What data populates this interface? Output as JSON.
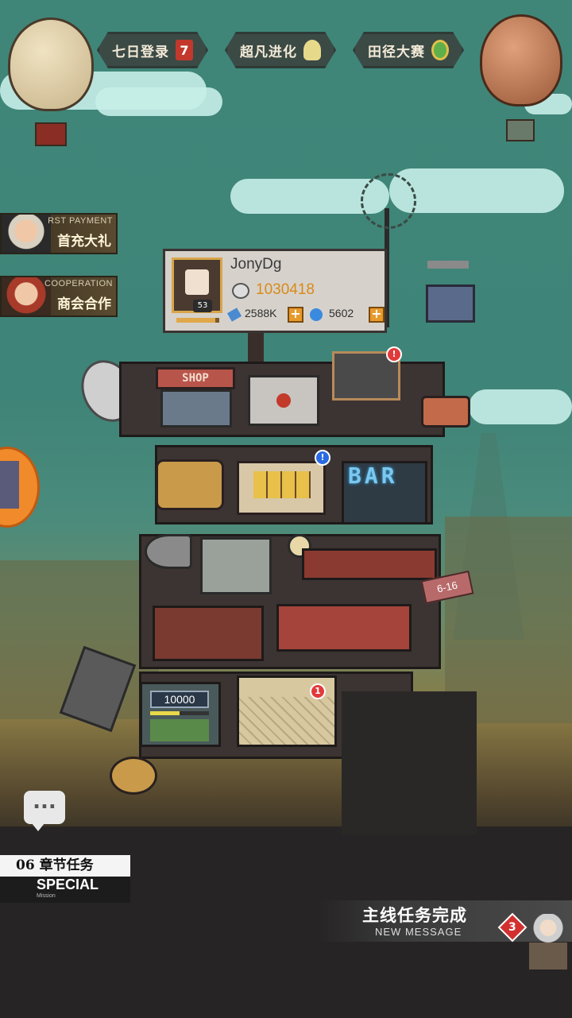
{
  "events": [
    {
      "label": "七日登录",
      "icon_name": "slot-seven-icon",
      "icon_text": "7",
      "icon_color": "#c2382c"
    },
    {
      "label": "超凡进化",
      "icon_name": "evolution-crystal-icon",
      "icon_text": "",
      "icon_color": "#e7d98a"
    },
    {
      "label": "田径大赛",
      "icon_name": "track-medal-icon",
      "icon_text": "",
      "icon_color": "#5fb04a"
    }
  ],
  "promos": [
    {
      "tag": "RST PAYMENT",
      "label": "首充大礼"
    },
    {
      "tag": "COOPERATION",
      "label": "商会合作"
    }
  ],
  "player": {
    "name": "JonyDg",
    "level": "53",
    "gold": "1030418",
    "crystal": "2588K",
    "gems": "5602",
    "xp_fraction": 0.9
  },
  "tower": {
    "shop_sign": "SHOP",
    "bar_sign": "BAR",
    "floor_tag": "6-16",
    "counter_value": "10000",
    "badge_notice_top": "!",
    "badge_notice_middle": "!",
    "badge_claw_count": "1"
  },
  "chat": {
    "icon_name": "chat-bubble-icon",
    "text": "..."
  },
  "mission": {
    "chapter": "06 章节任务",
    "title": "SPECIAL",
    "subtitle": "Mission"
  },
  "message": {
    "title": "主线任务完成",
    "subtitle": "NEW MESSAGE",
    "count": "3"
  },
  "colors": {
    "sky": "#3f8478",
    "gold_text": "#d98a1a",
    "alert_red": "#e23a3a",
    "alert_blue": "#2a6ae2"
  }
}
